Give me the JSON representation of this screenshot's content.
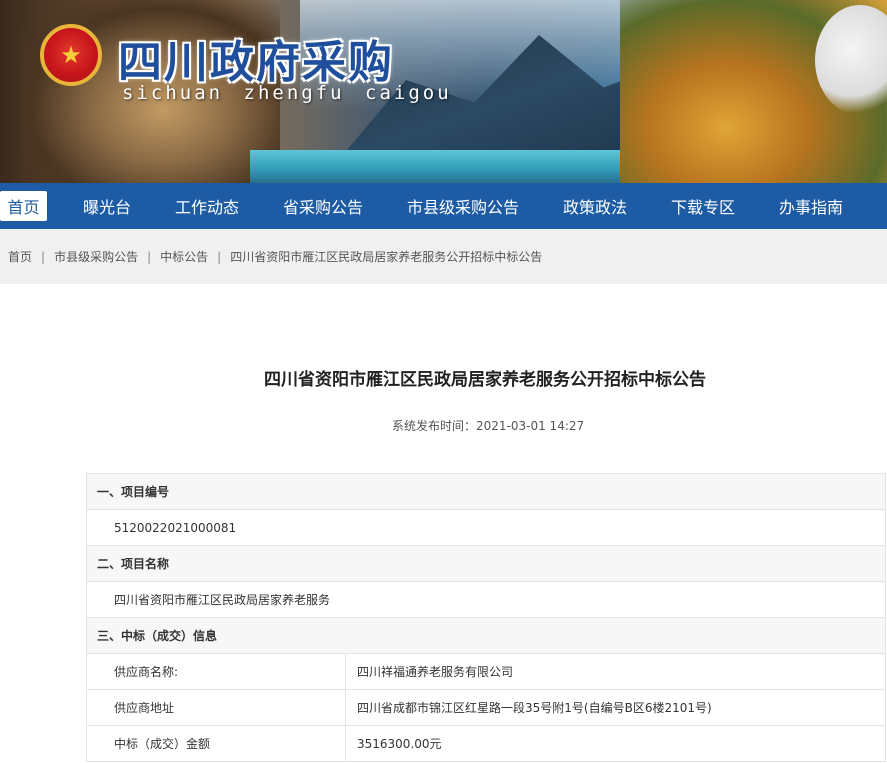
{
  "header": {
    "title": "四川政府采购",
    "pinyin": "sichuan zhengfu caigou"
  },
  "nav": {
    "items": [
      {
        "label": "首页",
        "active": true
      },
      {
        "label": "曝光台"
      },
      {
        "label": "工作动态"
      },
      {
        "label": "省采购公告"
      },
      {
        "label": "市县级采购公告"
      },
      {
        "label": "政策政法"
      },
      {
        "label": "下载专区"
      },
      {
        "label": "办事指南"
      }
    ]
  },
  "breadcrumb": {
    "items": [
      "首页",
      "市县级采购公告",
      "中标公告",
      "四川省资阳市雁江区民政局居家养老服务公开招标中标公告"
    ],
    "separator": "|"
  },
  "article": {
    "title": "四川省资阳市雁江区民政局居家养老服务公开招标中标公告",
    "publish_time": "系统发布时间：2021-03-01 14:27"
  },
  "info": {
    "sec1_title": "一、项目编号",
    "sec1_value": "5120022021000081",
    "sec2_title": "二、项目名称",
    "sec2_value": "四川省资阳市雁江区民政局居家养老服务",
    "sec3_title": "三、中标（成交）信息",
    "supplier_name_label": "供应商名称:",
    "supplier_name_value": "四川祥福通养老服务有限公司",
    "supplier_addr_label": "供应商地址",
    "supplier_addr_value": "四川省成都市锦江区红星路一段35号附1号(自编号B区6楼2101号)",
    "amount_label": "中标（成交）金额",
    "amount_value": "3516300.00元"
  },
  "colors": {
    "nav_bg": "#1d5ca5",
    "title_blue": "#1f4f9c"
  }
}
